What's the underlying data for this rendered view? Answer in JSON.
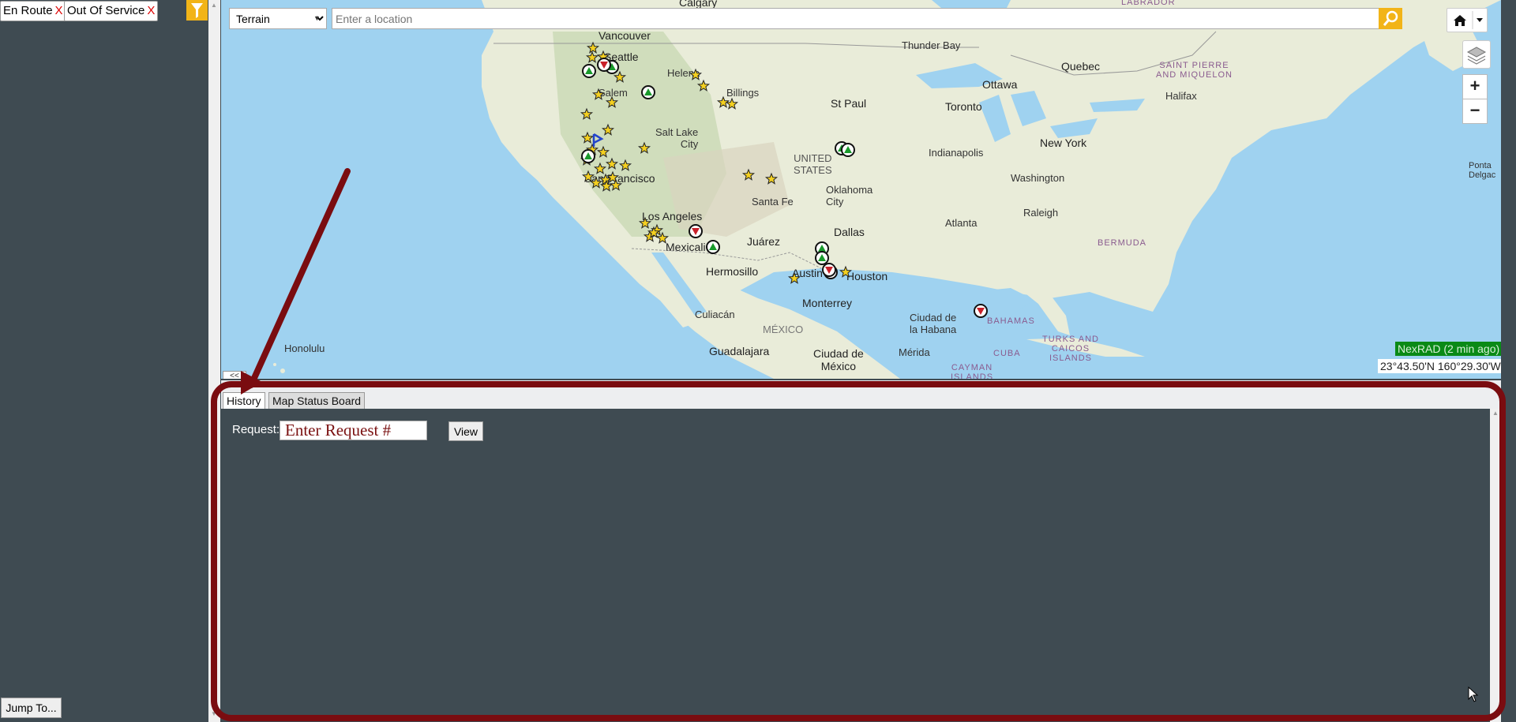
{
  "sidebar": {
    "filters": [
      {
        "label": "En Route",
        "remove": "X"
      },
      {
        "label": "Out Of Service",
        "remove": "X"
      }
    ],
    "filter_icon": "filter-icon",
    "jump_label": "Jump To..."
  },
  "map": {
    "map_type": "Terrain",
    "map_type_options": [
      "Terrain"
    ],
    "location_placeholder": "Enter a location",
    "search_icon": "search-icon",
    "home_icon": "home-icon",
    "layers_icon": "layers-icon",
    "zoom_in": "+",
    "zoom_out": "−",
    "collapse": "<<",
    "nexrad_status": "NexRAD (2 min ago)",
    "coordinates": "23°43.50'N 160°29.30'W",
    "labels": {
      "calgary": "Calgary",
      "vancouver": "Vancouver",
      "seattle": "Seattle",
      "salem": "Salem",
      "helena": "Helena",
      "billings": "Billings",
      "salt_lake": "Salt Lake\nCity",
      "san_francisco": "San Francisco",
      "los_angeles": "Los Angeles",
      "mexicali": "Mexicali",
      "santa_fe": "Santa Fe",
      "juarez": "Juárez",
      "hermosillo": "Hermosillo",
      "culiacan": "Culiacán",
      "guadalajara": "Guadalajara",
      "mexico": "MÉXICO",
      "ciudad_mexico": "Ciudad de\nMéxico",
      "monterrey": "Monterrey",
      "austin": "Austin",
      "houston": "Houston",
      "dallas": "Dallas",
      "oklahoma": "Oklahoma\nCity",
      "united_states": "UNITED\nSTATES",
      "st_paul": "St Paul",
      "thunder_bay": "Thunder Bay",
      "ottawa": "Ottawa",
      "quebec": "Quebec",
      "toronto": "Toronto",
      "halifax": "Halifax",
      "saint_pierre": "SAINT PIERRE\nAND MIQUELON",
      "new_york": "New York",
      "washington": "Washington",
      "indianapolis": "Indianapolis",
      "raleigh": "Raleigh",
      "atlanta": "Atlanta",
      "bermuda": "BERMUDA",
      "ciudad_habana": "Ciudad de\nla Habana",
      "merida": "Mérida",
      "bahamas": "BAHAMAS",
      "turks": "TURKS AND\nCAICOS\nISLANDS",
      "cuba": "CUBA",
      "cayman": "CAYMAN\nISLANDS",
      "honolulu": "Honolulu",
      "labrador": "LABRADOR",
      "ponta_delgada": "Ponta\nDelgac"
    }
  },
  "panel": {
    "tabs": [
      {
        "label": "History",
        "active": true
      },
      {
        "label": "Map Status Board",
        "active": false
      }
    ],
    "request_label": "Request:",
    "request_placeholder": "Enter Request #",
    "view_label": "View"
  },
  "colors": {
    "sidebar_bg": "#3f4b52",
    "accent": "#f2b418",
    "annotation": "#7a0c10",
    "nexrad_bg": "#0a8a16"
  }
}
